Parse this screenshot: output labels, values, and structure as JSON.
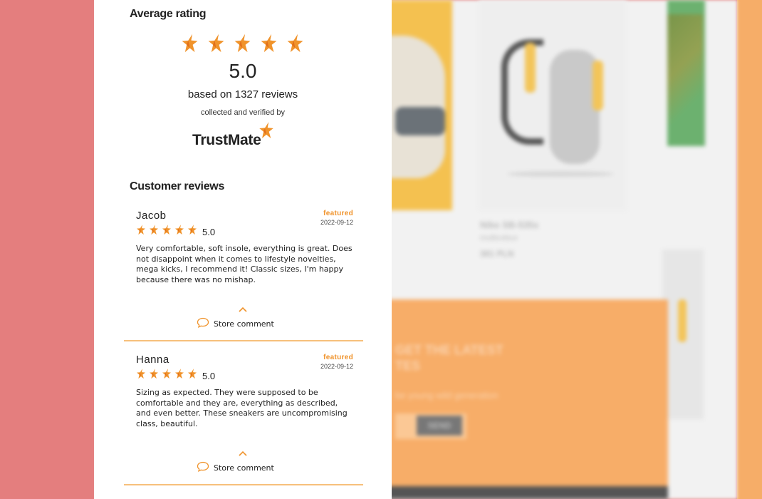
{
  "widget": {
    "average_title": "Average rating",
    "average_value": "5.0",
    "based_on": "based on 1327 reviews",
    "collected": "collected and verified by",
    "logo_text": "TrustMate",
    "reviews_title": "Customer reviews",
    "star_count": 5,
    "star_color": "#f0932b"
  },
  "reviews": [
    {
      "name": "Jacob",
      "badge": "featured",
      "date": "2022-09-12",
      "score": "5.0",
      "text": "Very comfortable, soft insole, everything is great. Does not disappoint when it comes to lifestyle novelties, mega kicks, I recommend it! Classic sizes, I'm happy because there was no mishap.",
      "store_label": "Store comment"
    },
    {
      "name": "Hanna",
      "badge": "featured",
      "date": "2022-09-12",
      "score": "5.0",
      "text": "Sizing as expected. They were supposed to be comfortable and they are, everything as described, and even better. These sneakers are uncompromising class, beautiful.",
      "store_label": "Store comment"
    }
  ],
  "background": {
    "product_name": "Nike SB-535x",
    "product_brand": "multicolour",
    "product_price": "381 PLN",
    "newsletter_heading_1": "GET THE LATEST",
    "newsletter_heading_2": "TES",
    "newsletter_sub": "be young wild generation",
    "newsletter_button": "SEND"
  },
  "colors": {
    "accent": "#f0932b",
    "left_bg": "#e47e7e",
    "right_bg": "#f6ad68"
  }
}
